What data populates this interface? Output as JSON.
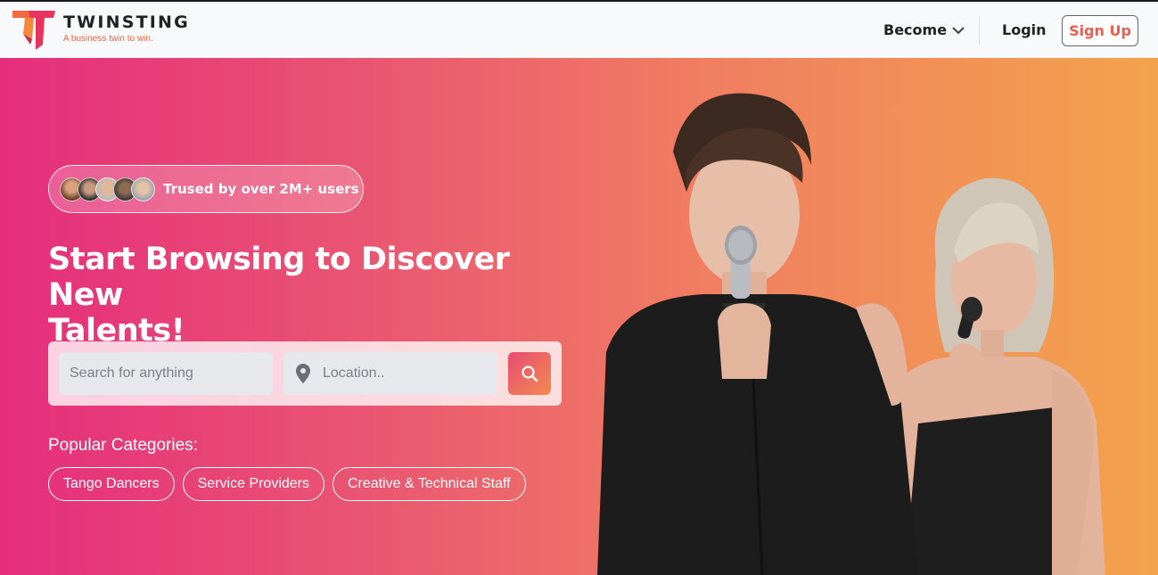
{
  "header": {
    "brand": "TWINSTING",
    "tagline": "A business twin to win.",
    "become_label": "Become",
    "login_label": "Login",
    "signup_label": "Sign Up"
  },
  "hero": {
    "trust_text": "Trused by over 2M+ users",
    "headline_line1": "Start Browsing to Discover New",
    "headline_line2": "Talents!",
    "search_placeholder": "Search for anything",
    "location_placeholder": "Location..",
    "popular_label": "Popular Categories:",
    "categories": [
      "Tango Dancers",
      "Service Providers",
      "Creative & Technical Staff"
    ]
  },
  "colors": {
    "gradient_start": "#e52d7c",
    "gradient_end": "#f3a34c",
    "signup_text": "#ee5b4f",
    "search_button": "#ec6a63"
  },
  "icons": {
    "logo": "twinsting-logo",
    "dropdown": "chevron-down-icon",
    "location": "location-pin-icon",
    "search": "search-icon"
  }
}
